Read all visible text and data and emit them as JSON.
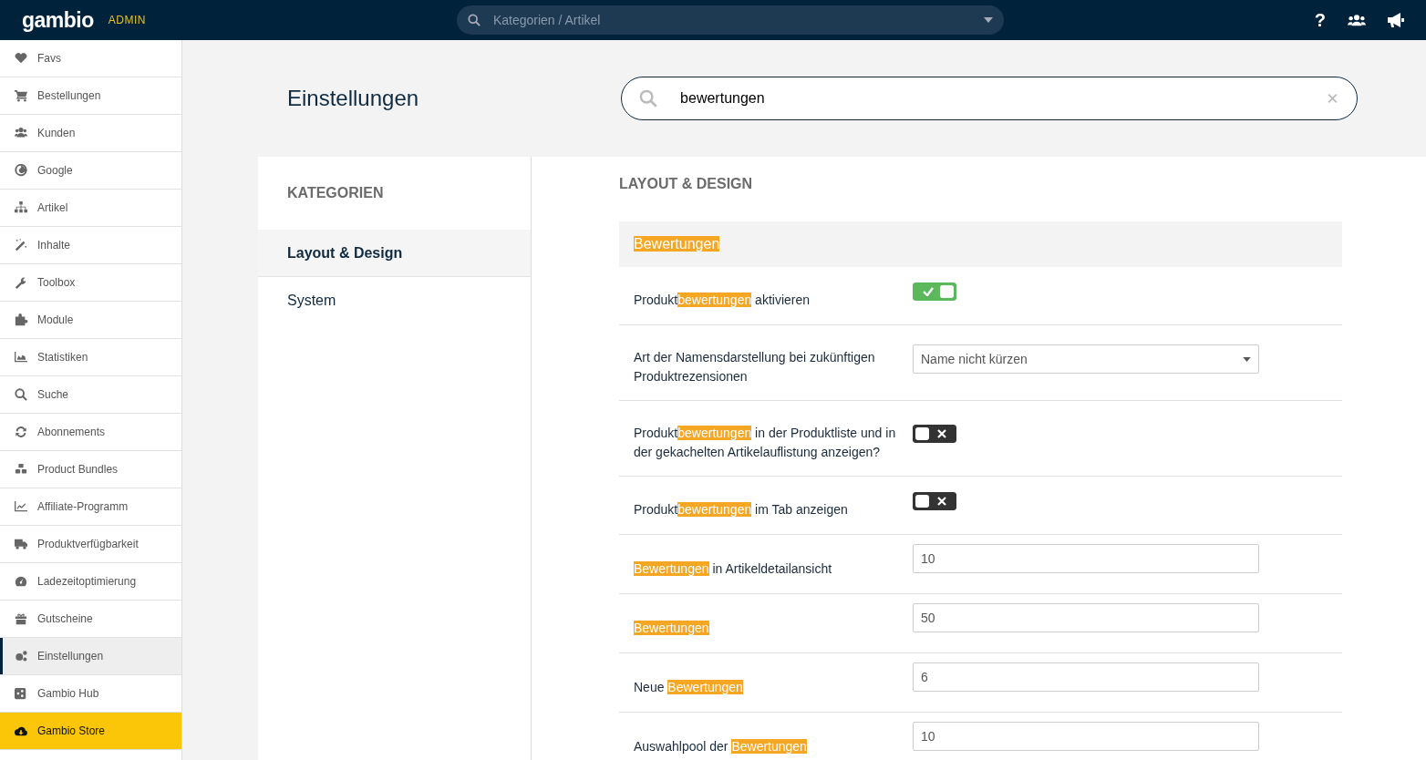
{
  "topbar": {
    "logo": "gambio",
    "badge": "ADMIN",
    "search": {
      "placeholder": "Kategorien / Artikel"
    },
    "help": "?"
  },
  "sidebar": {
    "items": [
      {
        "label": "Favs",
        "selected": false
      },
      {
        "label": "Bestellungen",
        "selected": false
      },
      {
        "label": "Kunden",
        "selected": false
      },
      {
        "label": "Google",
        "selected": false
      },
      {
        "label": "Artikel",
        "selected": false
      },
      {
        "label": "Inhalte",
        "selected": false
      },
      {
        "label": "Toolbox",
        "selected": false
      },
      {
        "label": "Module",
        "selected": false
      },
      {
        "label": "Statistiken",
        "selected": false
      },
      {
        "label": "Suche",
        "selected": false
      },
      {
        "label": "Abonnements",
        "selected": false
      },
      {
        "label": "Product Bundles",
        "selected": false
      },
      {
        "label": "Affiliate-Programm",
        "selected": false
      },
      {
        "label": "Produktverfügbarkeit",
        "selected": false
      },
      {
        "label": "Ladezeitoptimierung",
        "selected": false
      },
      {
        "label": "Gutscheine",
        "selected": false
      },
      {
        "label": "Einstellungen",
        "selected": true
      },
      {
        "label": "Gambio Hub",
        "selected": false
      },
      {
        "label": "Gambio Store",
        "selected": false,
        "featured": true
      }
    ]
  },
  "page": {
    "title": "Einstellungen",
    "search": {
      "value": "bewertungen"
    }
  },
  "categories": {
    "heading": "KATEGORIEN",
    "items": [
      {
        "label": "Layout & Design",
        "selected": true
      },
      {
        "label": "System",
        "selected": false
      }
    ]
  },
  "settings": {
    "heading": "LAYOUT & DESIGN",
    "group": [
      {
        "text": "Bewertungen",
        "highlight": true
      }
    ],
    "rows": [
      {
        "kind": "toggle",
        "on": true,
        "label": [
          {
            "text": "Produkt",
            "highlight": false
          },
          {
            "text": "bewertungen",
            "highlight": true
          },
          {
            "text": " aktivieren",
            "highlight": false
          }
        ]
      },
      {
        "kind": "select",
        "value": "Name nicht kürzen",
        "label": [
          {
            "text": "Art der Namensdarstellung bei zukünftigen Produktrezensionen",
            "highlight": false
          }
        ]
      },
      {
        "kind": "toggle",
        "on": false,
        "label": [
          {
            "text": "Produkt",
            "highlight": false
          },
          {
            "text": "bewertungen",
            "highlight": true
          },
          {
            "text": " in der Produktliste und in der gekachelten Artikelauflistung anzeigen?",
            "highlight": false
          }
        ]
      },
      {
        "kind": "toggle",
        "on": false,
        "label": [
          {
            "text": "Produkt",
            "highlight": false
          },
          {
            "text": "bewertungen",
            "highlight": true
          },
          {
            "text": " im Tab anzeigen",
            "highlight": false
          }
        ]
      },
      {
        "kind": "text",
        "value": "10",
        "label": [
          {
            "text": "Bewertungen",
            "highlight": true
          },
          {
            "text": " in Artikeldetailansicht",
            "highlight": false
          }
        ]
      },
      {
        "kind": "text",
        "value": "50",
        "label": [
          {
            "text": "Bewertungen",
            "highlight": true
          }
        ]
      },
      {
        "kind": "text",
        "value": "6",
        "label": [
          {
            "text": "Neue ",
            "highlight": false
          },
          {
            "text": "Bewertungen",
            "highlight": true
          }
        ]
      },
      {
        "kind": "text",
        "value": "10",
        "label": [
          {
            "text": "Auswahlpool der ",
            "highlight": false
          },
          {
            "text": "Bewertungen",
            "highlight": true
          }
        ]
      }
    ]
  }
}
